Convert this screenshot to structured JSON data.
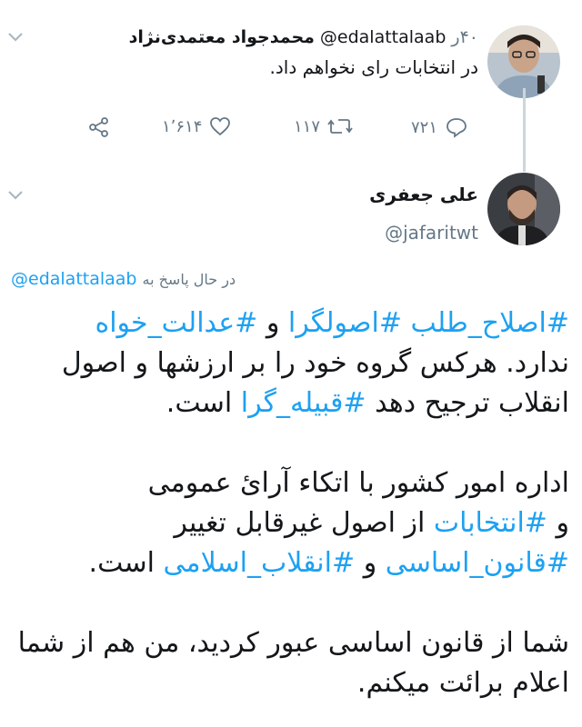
{
  "colors": {
    "link": "#1da1f2",
    "muted": "#657786",
    "text": "#14171a",
    "line": "#ccd6dd"
  },
  "parent_tweet": {
    "author_name": "محمدجواد معتمدی‌نژاد",
    "handle": "@edalattalaab",
    "time": "۴۰ر",
    "text": "در انتخابات رای نخواهم داد.",
    "reply_count": "۷۲۱",
    "retweet_count": "۱۱۷",
    "like_count": "۱٬۶۱۴"
  },
  "main_tweet": {
    "author_name": "علی جعفری",
    "handle": "@jafaritwt",
    "reply_prefix": "در حال پاسخ به",
    "reply_to": "@edalattalaab",
    "p1_hash1": "#اصلاح_طلب",
    "p1_hash2": "#اصولگرا",
    "p1_and": "و",
    "p1_hash3": "#عدالت_خواه",
    "p1_line2": "ندارد. هرکس گروه خود را بر ارزشها و اصول",
    "p1_line3_a": "انقلاب ترجیح دهد",
    "p1_hash4": "#قبیله_گرا",
    "p1_line3_b": "است.",
    "p2_line1": "اداره امور کشور با اتکاء آرائ عمومی",
    "p2_and": "و",
    "p2_hash1": "#انتخابات",
    "p2_line2_b": "از اصول غیرقابل تغییر",
    "p2_hash2": "#قانون_اساسی",
    "p2_and2": "و",
    "p2_hash3": "#انقلاب_اسلامی",
    "p2_end": "است.",
    "p3_line1": "شما از قانون اساسی عبور کردید، من هم از شما",
    "p3_line2": "اعلام برائت میکنم."
  },
  "icons": [
    "chevron-down-icon",
    "share-icon",
    "heart-icon",
    "retweet-icon",
    "reply-icon"
  ]
}
